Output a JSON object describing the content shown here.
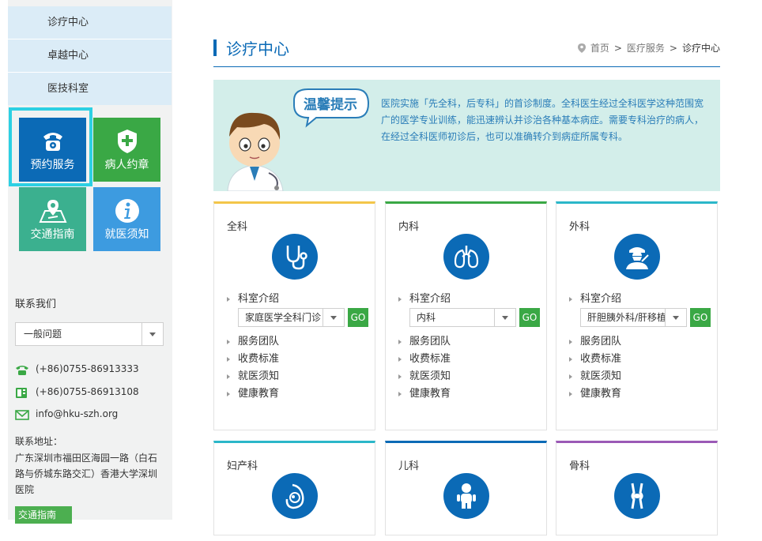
{
  "sidebar": {
    "menu": [
      "诊疗中心",
      "卓越中心",
      "医技科室"
    ],
    "tiles": {
      "booking": "预约服务",
      "pact": "病人约章",
      "traffic": "交通指南",
      "notice": "就医须知"
    },
    "contact": {
      "title": "联系我们",
      "select_value": "一般问题",
      "phone": "(+86)0755-86913333",
      "fax": "(+86)0755-86913108",
      "email": "info@hku-szh.org",
      "address_label": "联系地址：",
      "address": "广东深圳市福田区海园一路（白石路与侨城东路交汇）香港大学深圳医院",
      "traffic_button": "交通指南 >>"
    }
  },
  "header": {
    "title": "诊疗中心",
    "breadcrumb": [
      "首页",
      "医疗服务",
      "诊疗中心"
    ],
    "breadcrumb_sep": ">"
  },
  "notice": {
    "badge": "温馨提示",
    "text": "医院实施「先全科，后专科」的首诊制度。全科医生经过全科医学这种范围宽广的医学专业训练，能迅速辨认并诊治各种基本病症。需要专科治疗的病人，在经过全科医师初诊后，也可以准确转介到病症所属专科。"
  },
  "departments": [
    {
      "name": "全科",
      "icon": "stethoscope-icon",
      "accent": "#f3c64a",
      "intro": "科室介绍",
      "select_value": "家庭医学全科门诊",
      "go": "GO",
      "links": [
        "服务团队",
        "收费标准",
        "就医须知",
        "健康教育"
      ]
    },
    {
      "name": "内科",
      "icon": "lungs-icon",
      "accent": "#3aa845",
      "intro": "科室介绍",
      "select_value": "内科",
      "go": "GO",
      "links": [
        "服务团队",
        "收费标准",
        "就医须知",
        "健康教育"
      ]
    },
    {
      "name": "外科",
      "icon": "surgeon-icon",
      "accent": "#2bb7c9",
      "intro": "科室介绍",
      "select_value": "肝胆胰外科/肝移植",
      "go": "GO",
      "links": [
        "服务团队",
        "收费标准",
        "就医须知",
        "健康教育"
      ]
    },
    {
      "name": "妇产科",
      "icon": "pregnancy-icon",
      "accent": "#2bb7c9"
    },
    {
      "name": "儿科",
      "icon": "child-icon",
      "accent": "#0b6ab6"
    },
    {
      "name": "骨科",
      "icon": "knee-joint-icon",
      "accent": "#9b59b6"
    }
  ],
  "colors": {
    "brand_blue": "#0b6ab6",
    "green": "#3aa845",
    "highlight_cyan": "#2dd0e3",
    "notice_bg": "#d3eeea"
  }
}
